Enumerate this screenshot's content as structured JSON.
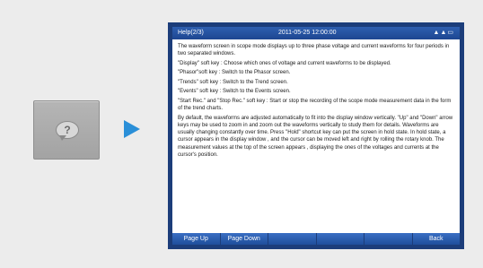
{
  "screen": {
    "title": "Help(2/3)",
    "datetime": "2011-05-25  12:00:00",
    "status_icons": "▲▲▭",
    "paragraphs": [
      "The waveform screen in scope mode displays up to three phase voltage and current waveforms for four periods in two separated windows.",
      "\"Display\" soft key : Choose which ones of voltage and current waveforms to be displayed.",
      "\"Phasor\"soft key : Switch to the Phasor screen.",
      "\"Trends\" soft key : Switch to the Trend screen.",
      "\"Events\" soft key : Switch to the Events screen.",
      "\"Start Rec.\" and \"Stop Rec.\" soft key : Start or stop the recording of the scope mode measurement data in the form of the trend charts.",
      "By default, the waveforms are adjusted automatically to fit into the display window vertically. \"Up\" and \"Down\" arrow keys may be used to zoom in and zoom out the waveforms vertically to study them for details. Waveforms are usually changing constantly over time. Press \"Hold\" shortcut key can put the screen in hold state. In hold state, a cursor appears in the display window , and the cursor can be moved left and right by rolling the rotary knob. The measurement values at the top of the screen appears , displaying the ones of the voltages and currents at the cursor's position."
    ],
    "softkeys": [
      "Page Up",
      "Page Down",
      "",
      "",
      "",
      "Back"
    ]
  },
  "help_key": {
    "symbol": "?"
  },
  "colors": {
    "frame": "#1c3d7a",
    "softkey": "#2b5bb0",
    "arrow": "#2a8fd8",
    "background": "#ececec"
  }
}
